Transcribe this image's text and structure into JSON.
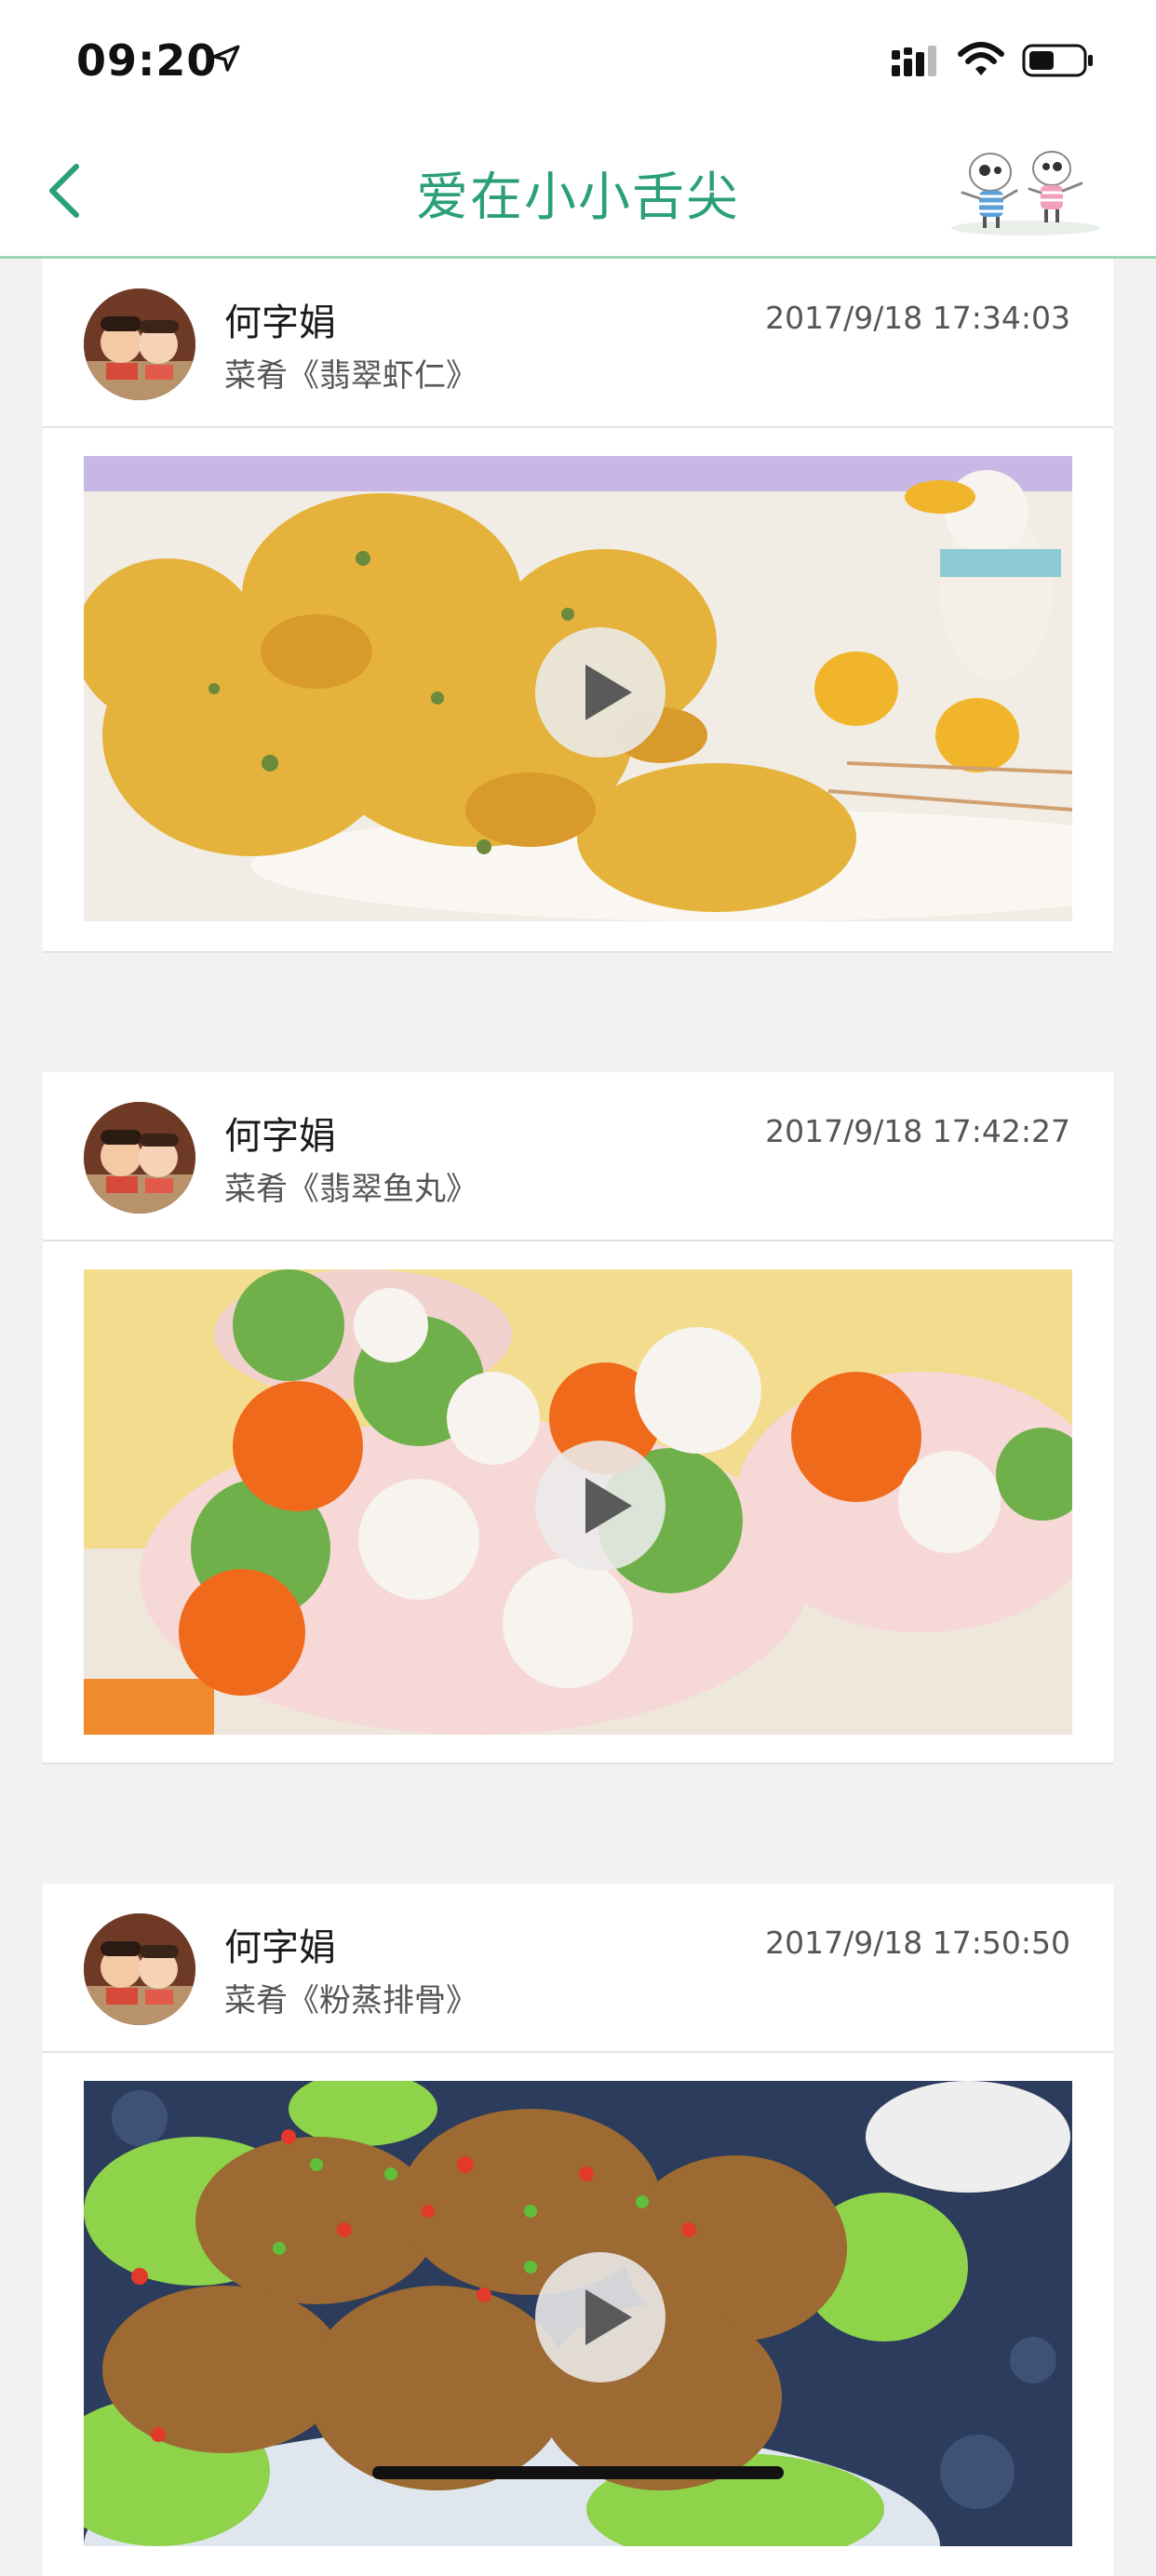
{
  "status_bar": {
    "time": "09:20"
  },
  "nav": {
    "title": "爱在小小舌尖"
  },
  "colors": {
    "accent": "#2aa074",
    "nav_line": "#9fd6b8",
    "background": "#f2f2f2"
  },
  "icons": {
    "back": "chevron-left-icon",
    "location": "location-arrow-icon",
    "signal": "cellular-signal-icon",
    "wifi": "wifi-icon",
    "battery": "battery-icon",
    "play": "play-icon"
  },
  "posts": [
    {
      "author": "何字娟",
      "dish": "菜肴《翡翠虾仁》",
      "timestamp": "2017/9/18 17:34:03"
    },
    {
      "author": "何字娟",
      "dish": "菜肴《翡翠鱼丸》",
      "timestamp": "2017/9/18 17:42:27"
    },
    {
      "author": "何字娟",
      "dish": "菜肴《粉蒸排骨》",
      "timestamp": "2017/9/18 17:50:50"
    }
  ]
}
